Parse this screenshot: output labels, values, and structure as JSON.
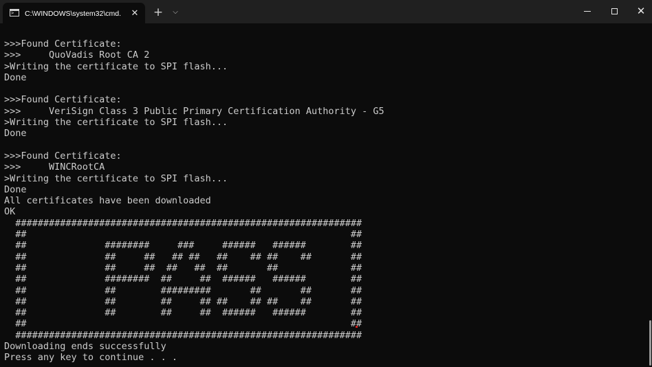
{
  "window": {
    "tab_title": "C:\\WINDOWS\\system32\\cmd.",
    "tab_close_glyph": "✕",
    "new_tab_glyph": "+",
    "dropdown_glyph": "⌵",
    "close_glyph": "✕"
  },
  "console": {
    "lines": [
      ">>>Found Certificate:",
      ">>>     QuoVadis Root CA 2",
      ">Writing the certificate to SPI flash...",
      "Done",
      "",
      ">>>Found Certificate:",
      ">>>     VeriSign Class 3 Public Primary Certification Authority - G5",
      ">Writing the certificate to SPI flash...",
      "Done",
      "",
      ">>>Found Certificate:",
      ">>>     WINCRootCA",
      ">Writing the certificate to SPI flash...",
      "Done",
      "All certificates have been downloaded",
      "OK",
      "  ##############################################################",
      "  ##                                                          ##",
      "  ##              ########     ###     ######   ######        ##",
      "  ##              ##     ##   ## ##   ##    ## ##    ##       ##",
      "  ##              ##     ##  ##   ##  ##       ##             ##",
      "  ##              ########  ##     ##  ######   ######        ##",
      "  ##              ##        #########       ##       ##       ##",
      "  ##              ##        ##     ## ##    ## ##    ##       ##",
      "  ##              ##        ##     ##  ######   ######        ##",
      "  ##                                                          ##",
      "  ##############################################################",
      "Downloading ends successfully",
      "Press any key to continue . . ."
    ]
  }
}
